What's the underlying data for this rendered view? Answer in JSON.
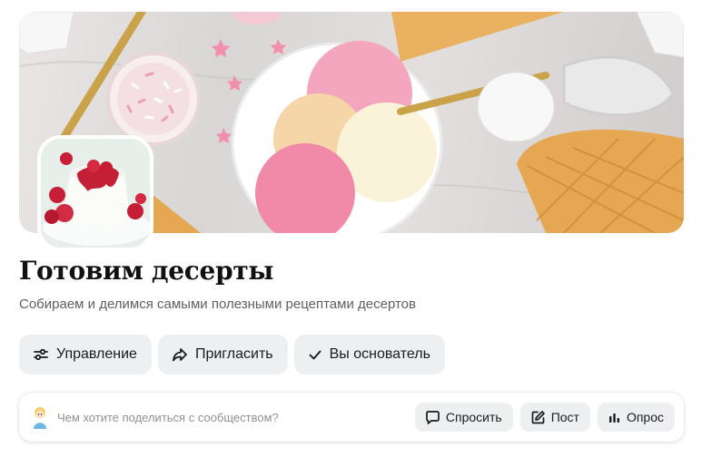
{
  "community": {
    "title": "Готовим десерты",
    "description": "Собираем и делимся самыми полезными рецептами десертов"
  },
  "actions": {
    "manage_label": "Управление",
    "invite_label": "Пригласить",
    "founder_label": "Вы основатель"
  },
  "composer": {
    "placeholder": "Чем хотите поделиться с сообществом?",
    "ask_label": "Спросить",
    "post_label": "Пост",
    "poll_label": "Опрос"
  },
  "icons": {
    "manage": "sliders-icon",
    "invite": "share-arrow-icon",
    "founder": "checkmark-icon",
    "ask": "speech-bubble-icon",
    "post": "edit-icon",
    "poll": "bar-chart-icon"
  },
  "colors": {
    "button_bg": "#eeeff1",
    "text_primary": "#1b1b1b",
    "text_secondary": "#5f5f63",
    "placeholder": "#8f9196"
  }
}
